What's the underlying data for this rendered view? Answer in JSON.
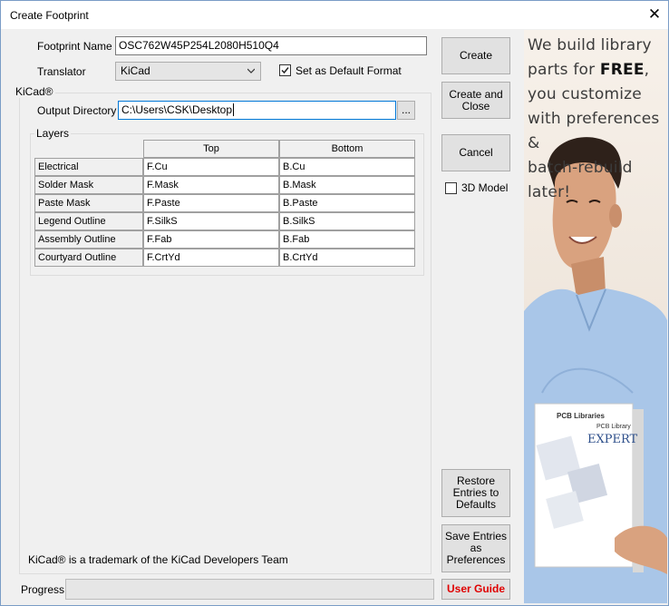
{
  "window": {
    "title": "Create Footprint"
  },
  "form": {
    "footprint_name_label": "Footprint Name",
    "footprint_name_value": "OSC762W45P254L2080H510Q4",
    "translator_label": "Translator",
    "translator_value": "KiCad",
    "default_format_label": "Set as Default Format",
    "default_format_checked": true
  },
  "kicad": {
    "group_label": "KiCad®",
    "output_dir_label": "Output Directory",
    "output_dir_value": "C:\\Users\\CSK\\Desktop",
    "browse_label": "...",
    "layers_label": "Layers",
    "columns": [
      "Top",
      "Bottom"
    ],
    "rows": [
      {
        "name": "Electrical",
        "top": "F.Cu",
        "bottom": "B.Cu"
      },
      {
        "name": "Solder Mask",
        "top": "F.Mask",
        "bottom": "B.Mask"
      },
      {
        "name": "Paste Mask",
        "top": "F.Paste",
        "bottom": "B.Paste"
      },
      {
        "name": "Legend Outline",
        "top": "F.SilkS",
        "bottom": "B.SilkS"
      },
      {
        "name": "Assembly Outline",
        "top": "F.Fab",
        "bottom": "B.Fab"
      },
      {
        "name": "Courtyard Outline",
        "top": "F.CrtYd",
        "bottom": "B.CrtYd"
      }
    ],
    "trademark": "KiCad® is a trademark of the KiCad Developers Team"
  },
  "buttons": {
    "create": "Create",
    "create_close_1": "Create and",
    "create_close_2": "Close",
    "cancel": "Cancel",
    "model3d": "3D Model",
    "restore_1": "Restore",
    "restore_2": "Entries to",
    "restore_3": "Defaults",
    "save_1": "Save Entries",
    "save_2": "as",
    "save_3": "Preferences",
    "user_guide": "User Guide"
  },
  "progress": {
    "label": "Progress",
    "value": 0
  },
  "ad": {
    "line1": "We build library",
    "line2a": "parts for ",
    "line2b": "FREE",
    "line2c": ",",
    "line3": "you customize",
    "line4": "with preferences &",
    "line5": "batch-rebuild later!",
    "box_brand": "PCB Libraries",
    "box_product": "PCB Library",
    "box_title": "EXPERT"
  },
  "colors": {
    "user_guide": "#e00000",
    "window_bg": "#f0f0f0"
  }
}
